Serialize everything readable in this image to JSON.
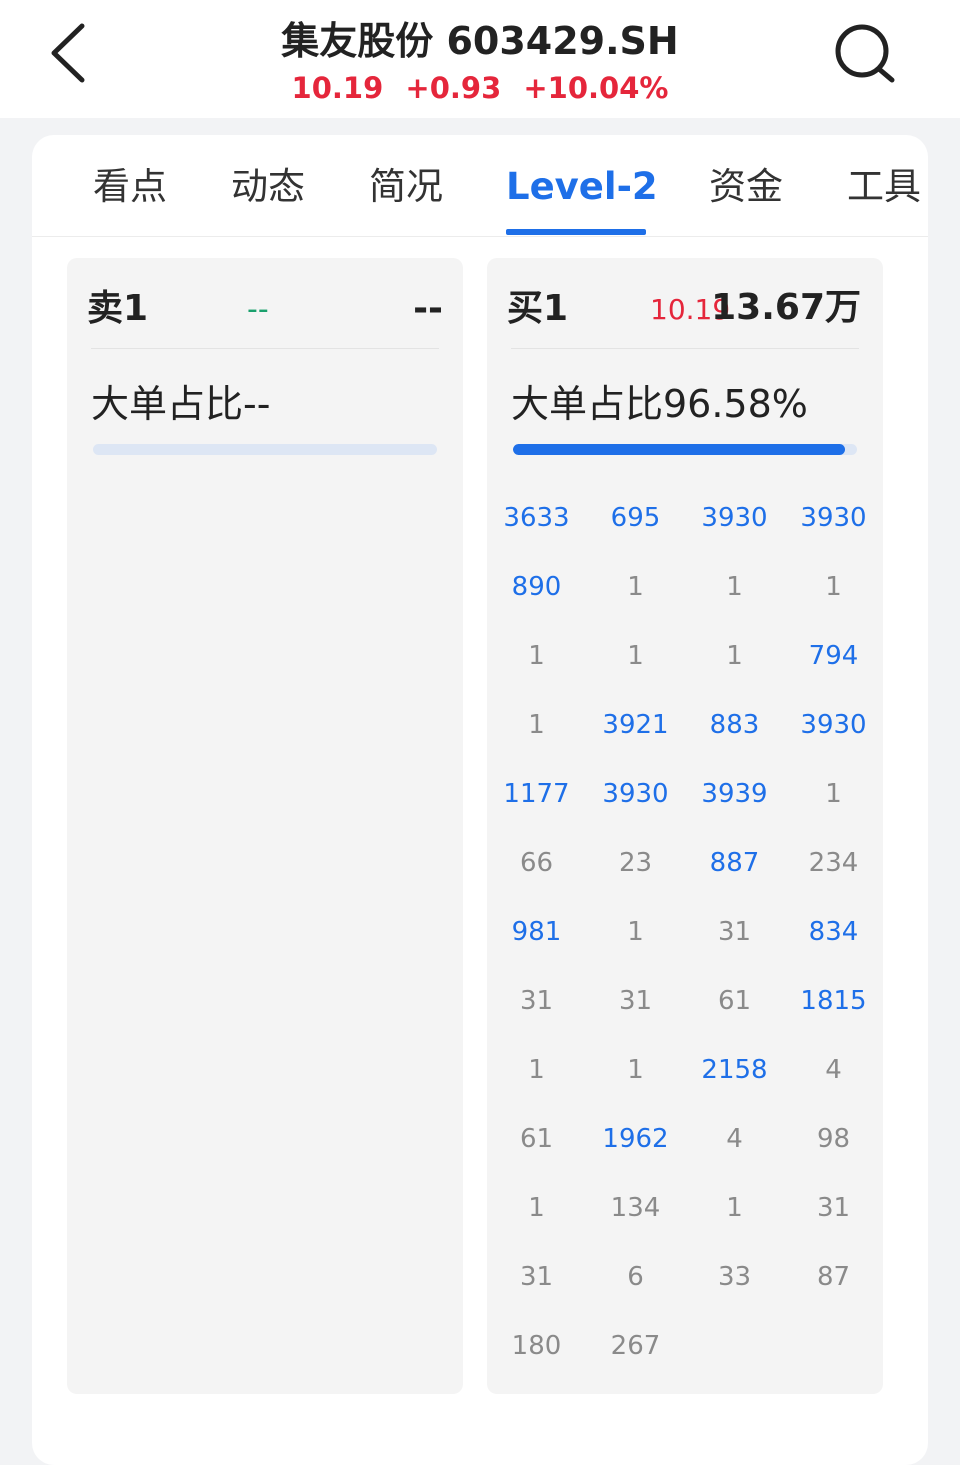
{
  "header": {
    "title": "集友股份 603429.SH",
    "price": "10.19",
    "change": "+0.93",
    "change_pct": "+10.04%",
    "back_icon": "chevron-left-icon",
    "search_icon": "search-icon"
  },
  "tabs": [
    {
      "label": "看点"
    },
    {
      "label": "动态"
    },
    {
      "label": "简况"
    },
    {
      "label": "Level-2",
      "active": true
    },
    {
      "label": "资金"
    },
    {
      "label": "工具"
    }
  ],
  "sell": {
    "label": "卖1",
    "price": "--",
    "volume": "--",
    "ratio_text": "大单占比--",
    "ratio": 0
  },
  "buy": {
    "label": "买1",
    "price": "10.19",
    "volume": "13.67万",
    "ratio_text": "大单占比96.58%",
    "ratio": 0.9658,
    "orders": [
      {
        "v": "3633",
        "big": true
      },
      {
        "v": "695",
        "big": true
      },
      {
        "v": "3930",
        "big": true
      },
      {
        "v": "3930",
        "big": true
      },
      {
        "v": "890",
        "big": true
      },
      {
        "v": "1",
        "big": false
      },
      {
        "v": "1",
        "big": false
      },
      {
        "v": "1",
        "big": false
      },
      {
        "v": "1",
        "big": false
      },
      {
        "v": "1",
        "big": false
      },
      {
        "v": "1",
        "big": false
      },
      {
        "v": "794",
        "big": true
      },
      {
        "v": "1",
        "big": false
      },
      {
        "v": "3921",
        "big": true
      },
      {
        "v": "883",
        "big": true
      },
      {
        "v": "3930",
        "big": true
      },
      {
        "v": "1177",
        "big": true
      },
      {
        "v": "3930",
        "big": true
      },
      {
        "v": "3939",
        "big": true
      },
      {
        "v": "1",
        "big": false
      },
      {
        "v": "66",
        "big": false
      },
      {
        "v": "23",
        "big": false
      },
      {
        "v": "887",
        "big": true
      },
      {
        "v": "234",
        "big": false
      },
      {
        "v": "981",
        "big": true
      },
      {
        "v": "1",
        "big": false
      },
      {
        "v": "31",
        "big": false
      },
      {
        "v": "834",
        "big": true
      },
      {
        "v": "31",
        "big": false
      },
      {
        "v": "31",
        "big": false
      },
      {
        "v": "61",
        "big": false
      },
      {
        "v": "1815",
        "big": true
      },
      {
        "v": "1",
        "big": false
      },
      {
        "v": "1",
        "big": false
      },
      {
        "v": "2158",
        "big": true
      },
      {
        "v": "4",
        "big": false
      },
      {
        "v": "61",
        "big": false
      },
      {
        "v": "1962",
        "big": true
      },
      {
        "v": "4",
        "big": false
      },
      {
        "v": "98",
        "big": false
      },
      {
        "v": "1",
        "big": false
      },
      {
        "v": "134",
        "big": false
      },
      {
        "v": "1",
        "big": false
      },
      {
        "v": "31",
        "big": false
      },
      {
        "v": "31",
        "big": false
      },
      {
        "v": "6",
        "big": false
      },
      {
        "v": "33",
        "big": false
      },
      {
        "v": "87",
        "big": false
      },
      {
        "v": "180",
        "big": false
      },
      {
        "v": "267",
        "big": false
      }
    ]
  },
  "colors": {
    "accent": "#1e6fe8",
    "up_red": "#e5263b",
    "down_green": "#1aa06d"
  }
}
